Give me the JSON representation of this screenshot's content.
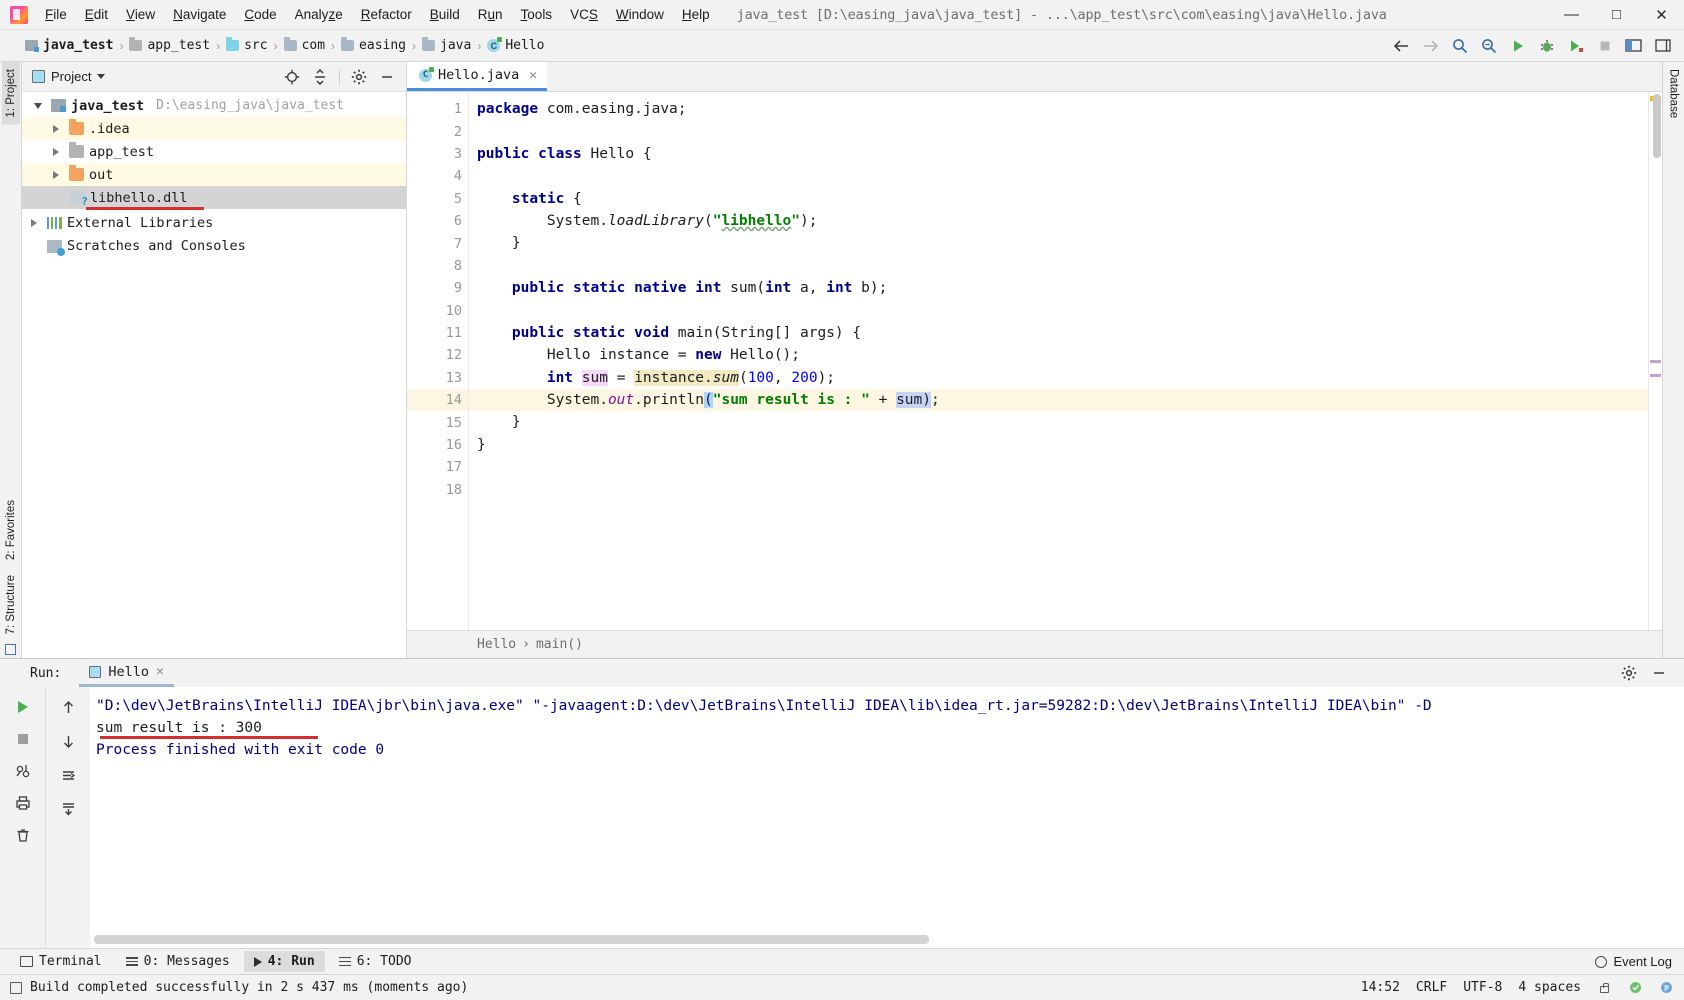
{
  "window": {
    "title": "java_test [D:\\easing_java\\java_test] - ...\\app_test\\src\\com\\easing\\java\\Hello.java",
    "minimize": "—",
    "maximize": "□",
    "close": "✕"
  },
  "menubar": {
    "items": [
      {
        "label": "File"
      },
      {
        "label": "Edit"
      },
      {
        "label": "View"
      },
      {
        "label": "Navigate"
      },
      {
        "label": "Code"
      },
      {
        "label": "Analyze"
      },
      {
        "label": "Refactor"
      },
      {
        "label": "Build"
      },
      {
        "label": "Run"
      },
      {
        "label": "Tools"
      },
      {
        "label": "VCS"
      },
      {
        "label": "Window"
      },
      {
        "label": "Help"
      }
    ]
  },
  "breadcrumb": {
    "items": [
      {
        "label": "java_test",
        "icon": "module-icon"
      },
      {
        "label": "app_test",
        "icon": "folder-grey-icon"
      },
      {
        "label": "src",
        "icon": "folder-blue-icon"
      },
      {
        "label": "com",
        "icon": "package-icon"
      },
      {
        "label": "easing",
        "icon": "package-icon"
      },
      {
        "label": "java",
        "icon": "package-icon"
      },
      {
        "label": "Hello",
        "icon": "class-icon"
      }
    ],
    "separator": "›"
  },
  "navbar_actions": [
    {
      "name": "back-arrow-icon"
    },
    {
      "name": "forward-arrow-icon"
    },
    {
      "name": "search-everywhere-icon"
    },
    {
      "name": "find-icon"
    },
    {
      "name": "run-icon"
    },
    {
      "name": "debug-icon"
    },
    {
      "name": "run-coverage-icon"
    },
    {
      "name": "stop-icon"
    },
    {
      "name": "layout-icon"
    },
    {
      "name": "settings-toggle-icon"
    }
  ],
  "project_panel": {
    "title": "Project",
    "actions": [
      "locate-icon",
      "collapse-all-icon",
      "gear-icon",
      "hide-icon"
    ],
    "tree": [
      {
        "label": "java_test",
        "path": "D:\\easing_java\\java_test",
        "icon": "project-icon",
        "expanded": true,
        "indent": 0,
        "bold": true,
        "highlight": "none"
      },
      {
        "label": ".idea",
        "path": "",
        "icon": "folder-orange-icon",
        "expanded": false,
        "indent": 1,
        "bold": false,
        "highlight": "yellow"
      },
      {
        "label": "app_test",
        "path": "",
        "icon": "folder-grey-icon",
        "expanded": false,
        "indent": 1,
        "bold": false,
        "highlight": "none"
      },
      {
        "label": "out",
        "path": "",
        "icon": "folder-orange-icon",
        "expanded": false,
        "indent": 1,
        "bold": false,
        "highlight": "yellow"
      },
      {
        "label": "libhello.dll",
        "path": "",
        "icon": "file-unknown-icon",
        "expanded": null,
        "indent": 2,
        "bold": false,
        "highlight": "selected"
      },
      {
        "label": "External Libraries",
        "path": "",
        "icon": "libraries-icon",
        "expanded": false,
        "indent": 0,
        "bold": false,
        "highlight": "none"
      },
      {
        "label": "Scratches and Consoles",
        "path": "",
        "icon": "scratches-icon",
        "expanded": null,
        "indent": 0,
        "bold": false,
        "highlight": "none"
      }
    ]
  },
  "left_rail": {
    "tabs": [
      {
        "label": "1: Project",
        "active": true
      },
      {
        "label": "2: Favorites",
        "active": false
      },
      {
        "label": "7: Structure",
        "active": false
      }
    ]
  },
  "right_rail": {
    "tabs": [
      {
        "label": "Database",
        "active": false
      }
    ]
  },
  "editor": {
    "tab": {
      "label": "Hello.java",
      "close": "✕",
      "icon": "java-class-icon"
    },
    "breadcrumb": {
      "class": "Hello",
      "method": "main()",
      "separator": "›"
    },
    "line_count": 18,
    "highlighted_line": 14,
    "lines": [
      {
        "n": 1,
        "text": "package com.easing.java;"
      },
      {
        "n": 2,
        "text": ""
      },
      {
        "n": 3,
        "text": "public class Hello {",
        "runmarker": true
      },
      {
        "n": 4,
        "text": ""
      },
      {
        "n": 5,
        "text": "    static {",
        "fold": "open"
      },
      {
        "n": 6,
        "text": "        System.loadLibrary(\"libhello\");"
      },
      {
        "n": 7,
        "text": "    }",
        "fold": "close"
      },
      {
        "n": 8,
        "text": ""
      },
      {
        "n": 9,
        "text": "    public static native int sum(int a, int b);"
      },
      {
        "n": 10,
        "text": ""
      },
      {
        "n": 11,
        "text": "    public static void main(String[] args) {",
        "runmarker": true,
        "fold": "open"
      },
      {
        "n": 12,
        "text": "        Hello instance = new Hello();"
      },
      {
        "n": 13,
        "text": "        int sum = instance.sum(100, 200);"
      },
      {
        "n": 14,
        "text": "        System.out.println(\"sum result is : \" + sum);"
      },
      {
        "n": 15,
        "text": "    }",
        "fold": "close"
      },
      {
        "n": 16,
        "text": "}"
      },
      {
        "n": 17,
        "text": ""
      },
      {
        "n": 18,
        "text": ""
      }
    ]
  },
  "run_panel": {
    "label": "Run:",
    "tab": {
      "label": "Hello",
      "close": "✕"
    },
    "toolbar": [
      "rerun-icon",
      "stop-icon",
      "filter-icon",
      "print-icon",
      "trash-icon"
    ],
    "toolbar2": [
      "scroll-up-icon",
      "scroll-down-icon",
      "soft-wrap-icon",
      "scroll-to-end-icon"
    ],
    "head_actions": [
      "gear-icon",
      "hide-icon"
    ],
    "console": [
      {
        "text": "\"D:\\dev\\JetBrains\\IntelliJ IDEA\\jbr\\bin\\java.exe\" \"-javaagent:D:\\dev\\JetBrains\\IntelliJ IDEA\\lib\\idea_rt.jar=59282:D:\\dev\\JetBrains\\IntelliJ IDEA\\bin\" -D",
        "type": "cmd"
      },
      {
        "text": "sum result is : 300",
        "type": "out"
      },
      {
        "text": "",
        "type": "out"
      },
      {
        "text": "Process finished with exit code 0",
        "type": "cmd"
      }
    ]
  },
  "bottom_tabs": [
    {
      "label": "Terminal",
      "icon": "terminal-icon",
      "active": false
    },
    {
      "label": "0: Messages",
      "icon": "messages-icon",
      "active": false
    },
    {
      "label": "4: Run",
      "icon": "run-icon",
      "active": true
    },
    {
      "label": "6: TODO",
      "icon": "todo-icon",
      "active": false
    }
  ],
  "bottom_right": {
    "label": "Event Log",
    "icon": "event-log-icon"
  },
  "statusbar": {
    "message": "Build completed successfully in 2 s 437 ms (moments ago)",
    "time": "14:52",
    "line_sep": "CRLF",
    "encoding": "UTF-8",
    "indent": "4 spaces",
    "icons": [
      "lock-icon",
      "inspections-icon",
      "notifications-icon"
    ]
  },
  "colors": {
    "accent": "#4a90d9",
    "keyword": "#00008f",
    "string": "#008000",
    "number": "#0000ff",
    "highlight_line": "#fdf6e3",
    "redline": "#d32f2f",
    "selection": "#c5d4f5"
  }
}
